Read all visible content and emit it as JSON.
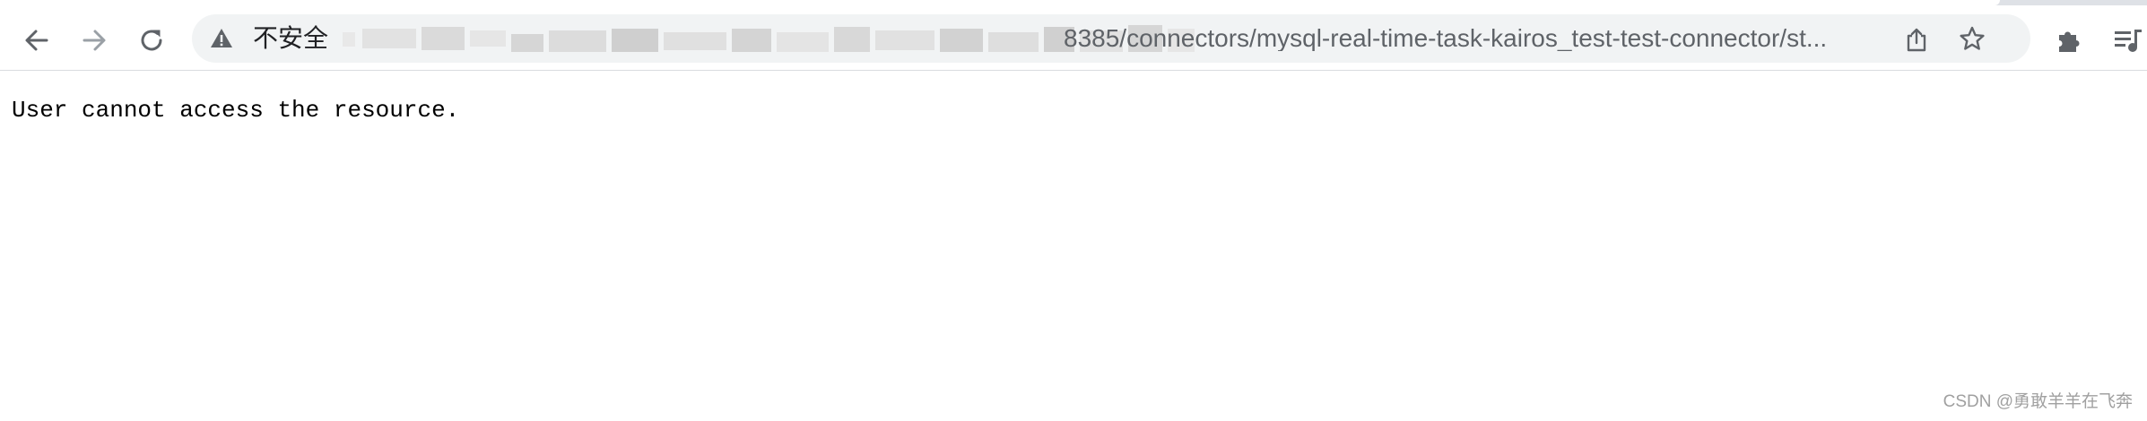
{
  "browser": {
    "nav": {
      "back_icon": "arrow-left-icon",
      "forward_icon": "arrow-right-icon",
      "reload_icon": "reload-icon"
    },
    "omnibox": {
      "security_label": "不安全",
      "url_visible": "8385/connectors/mysql-real-time-task-kairos_test-test-connector/st...",
      "host_redacted": true,
      "warning_icon": "warning-triangle-icon",
      "share_icon": "share-icon",
      "bookmark_icon": "star-icon"
    },
    "toolbar_icons": {
      "extensions_icon": "puzzle-piece-icon",
      "media_icon": "media-queue-icon"
    }
  },
  "page": {
    "message": "User cannot access the resource."
  },
  "watermark": {
    "text": "CSDN @勇敢羊羊在飞奔"
  },
  "colors": {
    "toolbar_bg": "#ffffff",
    "omnibox_bg": "#f1f3f4",
    "icon_color": "#5f6368",
    "disabled_icon_color": "#9aa0a6",
    "text_dark": "#202124",
    "url_text": "#5f6368"
  }
}
